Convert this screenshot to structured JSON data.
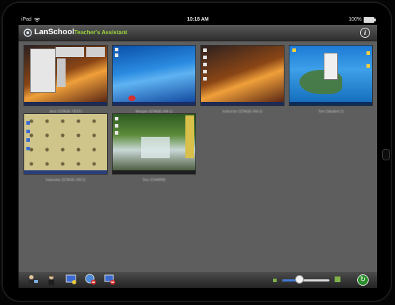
{
  "status_bar": {
    "device": "iPad",
    "time": "10:18 AM",
    "battery": "100%"
  },
  "app_bar": {
    "title": "LanSchool",
    "subtitle": "Teacher's Assistant",
    "info_icon": "info-icon",
    "info_glyph": "i"
  },
  "students": [
    {
      "name": "Jess (STAGE-TEST)",
      "wallpaper": "desert-sunset",
      "window": true
    },
    {
      "name": "Morgan (STAGE-VM-1)",
      "wallpaper": "windows-blue",
      "window": false
    },
    {
      "name": "Instructor (STAGE-VM-3)",
      "wallpaper": "desert-sunset",
      "window": false
    },
    {
      "name": "Tom (Student 2)",
      "wallpaper": "turtle-ocean",
      "window": true
    },
    {
      "name": "Instructor (STAGE-VM-2)",
      "wallpaper": "flower-pattern",
      "window": false
    },
    {
      "name": "Doc (CHARM)",
      "wallpaper": "waterfall",
      "window": false
    }
  ],
  "toolbar": {
    "icons": [
      "teacher-icon",
      "student-icon",
      "blank-screen-icon",
      "limit-web-icon",
      "limit-apps-icon"
    ],
    "thumbnail_size": 0.35,
    "refresh_glyph": "↻"
  },
  "colors": {
    "accent": "#9bd63c",
    "screen_bg": "#5e5e5e",
    "slider_fill": "#3f7bd6"
  }
}
